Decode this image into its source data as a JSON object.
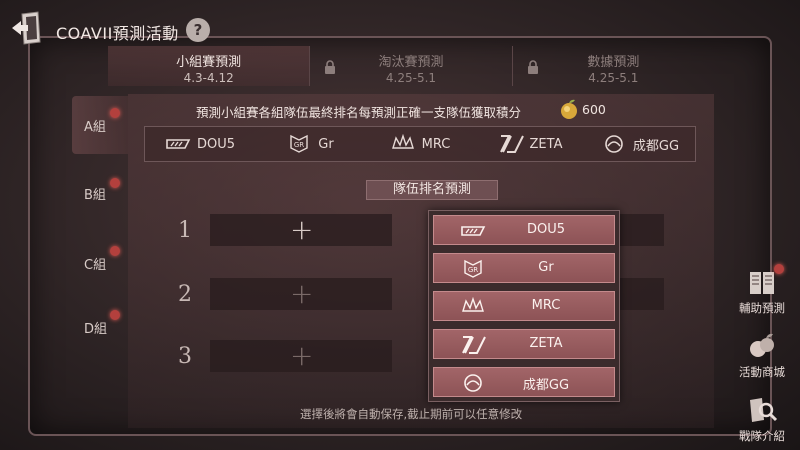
{
  "header": {
    "title": "COAVII預測活動",
    "help_label": "?"
  },
  "tabs": [
    {
      "name": "小組賽預測",
      "date": "4.3-4.12",
      "active": true,
      "locked": false
    },
    {
      "name": "淘汰賽預測",
      "date": "4.25-5.1",
      "active": false,
      "locked": true
    },
    {
      "name": "數據預測",
      "date": "4.25-5.1",
      "active": false,
      "locked": true
    }
  ],
  "groups": [
    {
      "label": "A組",
      "active": true
    },
    {
      "label": "B組",
      "active": false
    },
    {
      "label": "C組",
      "active": false
    },
    {
      "label": "D組",
      "active": false
    }
  ],
  "rule": {
    "text": "預測小組賽各組隊伍最終排名每預測正確一支隊伍獲取積分",
    "reward": "600",
    "reward_icon": "gold-apple-icon"
  },
  "teams": [
    {
      "name": "DOU5",
      "icon": "dou5-logo-icon"
    },
    {
      "name": "Gr",
      "icon": "gr-glory-logo-icon"
    },
    {
      "name": "MRC",
      "icon": "mrc-crown-logo-icon"
    },
    {
      "name": "ZETA",
      "icon": "zeta-logo-icon"
    },
    {
      "name": "成都GG",
      "icon": "chengdu-gg-logo-icon"
    }
  ],
  "ranking": {
    "title": "隊伍排名預測",
    "slots": [
      {
        "number": "1",
        "add_label": "+"
      },
      {
        "number": "2",
        "add_label": "+"
      },
      {
        "number": "3",
        "add_label": "+"
      }
    ]
  },
  "dropdown": {
    "options": [
      "DOU5",
      "Gr",
      "MRC",
      "ZETA",
      "成都GG"
    ]
  },
  "footnote": "選擇後將會自動保存,截止期前可以任意修改",
  "side_menu": [
    {
      "label": "輔助預測",
      "icon": "book-icon",
      "badge": true
    },
    {
      "label": "活動商城",
      "icon": "apples-icon",
      "badge": false
    },
    {
      "label": "戰隊介紹",
      "icon": "magnifier-icon",
      "badge": false
    }
  ],
  "colors": {
    "accent_red": "#b3403d",
    "option_bg": "#a26568",
    "panel_bg": "#2e2425"
  }
}
